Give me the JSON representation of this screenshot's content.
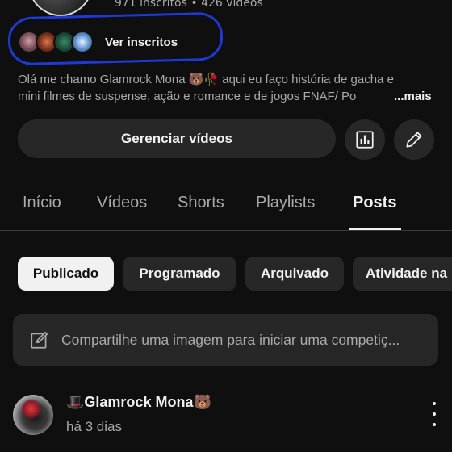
{
  "channel": {
    "stats": "971 inscritos • 426 vídeos",
    "subscribers_label": "Ver inscritos",
    "description_line1": "Olá me chamo Glamrock Mona 🐻🥀 aqui eu faço história de gacha e",
    "description_line2": "mini filmes de suspense, ação e romance e de jogos FNAF/ Po",
    "more_label": "...mais"
  },
  "actions": {
    "manage_videos": "Gerenciar vídeos",
    "analytics_icon": "bar-chart-icon",
    "edit_icon": "pencil-icon"
  },
  "tabs": [
    {
      "label": "Início"
    },
    {
      "label": "Vídeos"
    },
    {
      "label": "Shorts"
    },
    {
      "label": "Playlists"
    },
    {
      "label": "Posts",
      "active": true
    }
  ],
  "filters": [
    {
      "label": "Publicado",
      "active": true
    },
    {
      "label": "Programado"
    },
    {
      "label": "Arquivado"
    },
    {
      "label": "Atividade na"
    }
  ],
  "composer": {
    "placeholder": "Compartilhe uma imagem para iniciar uma competiç..."
  },
  "post": {
    "author": "🎩Glamrock Mona🐻",
    "time": "há 3 dias"
  },
  "colors": {
    "background": "#0f0f0f",
    "surface": "#272727",
    "highlight": "#1d39d8"
  }
}
